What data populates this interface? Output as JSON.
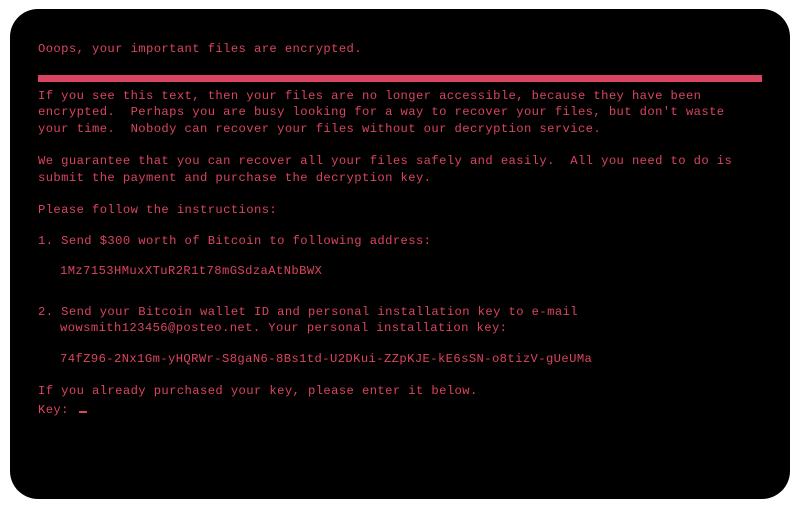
{
  "title": "Ooops, your important files are encrypted.",
  "paragraph1": "If you see this text, then your files are no longer accessible, because they have been encrypted.  Perhaps you are busy looking for a way to recover your files, but don't waste your time.  Nobody can recover your files without our decryption service.",
  "paragraph2": "We guarantee that you can recover all your files safely and easily.  All you need to do is submit the payment and purchase the decryption key.",
  "instructions_label": "Please follow the instructions:",
  "step1": "1. Send $300 worth of Bitcoin to following address:",
  "bitcoin_address": "1Mz7153HMuxXTuR2R1t78mGSdzaAtNbBWX",
  "step2_line1": "2. Send your Bitcoin wallet ID and personal installation key to e-mail",
  "step2_line2": "wowsmith123456@posteo.net. Your personal installation key:",
  "installation_key": "74fZ96-2Nx1Gm-yHQRWr-S8gaN6-8Bs1td-U2DKui-ZZpKJE-kE6sSN-o8tizV-gUeUMa",
  "purchased_note": "If you already purchased your key, please enter it below.",
  "key_prompt": "Key:",
  "colors": {
    "background": "#000000",
    "text": "#d94560",
    "divider": "#d94560"
  }
}
